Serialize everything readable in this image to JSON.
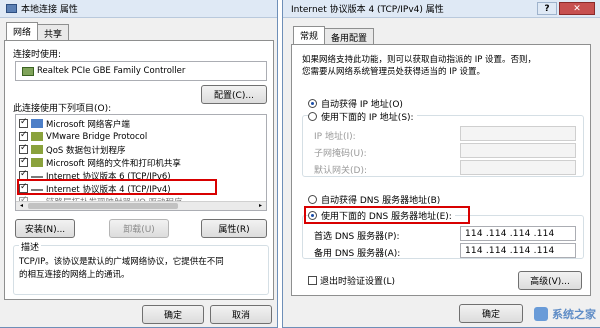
{
  "left_window": {
    "title": "本地连接 属性",
    "tabs": [
      "网络",
      "共享"
    ],
    "connect_using_label": "连接时使用:",
    "adapter": "Realtek PCIe GBE Family Controller",
    "configure_button": "配置(C)...",
    "items_label": "此连接使用下列项目(O):",
    "items": [
      {
        "label": "Microsoft 网络客户端",
        "checked": true
      },
      {
        "label": "VMware Bridge Protocol",
        "checked": true
      },
      {
        "label": "QoS 数据包计划程序",
        "checked": true
      },
      {
        "label": "Microsoft 网络的文件和打印机共享",
        "checked": true
      },
      {
        "label": "Internet 协议版本 6 (TCP/IPv6)",
        "checked": true
      },
      {
        "label": "Internet 协议版本 4 (TCP/IPv4)",
        "checked": true
      },
      {
        "label": "链路层拓扑发现映射器 I/O 驱动程序",
        "checked": true
      }
    ],
    "install_button": "安装(N)...",
    "uninstall_button": "卸载(U)",
    "properties_button": "属性(R)",
    "description_label": "描述",
    "description_text_1": "TCP/IP。该协议是默认的广域网络协议，它提供在不同",
    "description_text_2": "的相互连接的网络上的通讯。",
    "ok_button": "确定",
    "cancel_button": "取消"
  },
  "right_window": {
    "title": "Internet 协议版本 4 (TCP/IPv4) 属性",
    "tabs": [
      "常规",
      "备用配置"
    ],
    "intro_1": "如果网络支持此功能，则可以获取自动指派的 IP 设置。否则，",
    "intro_2": "您需要从网络系统管理员处获得适当的 IP 设置。",
    "auto_ip_label": "自动获得 IP 地址(O)",
    "manual_ip_label": "使用下面的 IP 地址(S):",
    "ip_address_label": "IP 地址(I):",
    "subnet_label": "子网掩码(U):",
    "gateway_label": "默认网关(D):",
    "auto_dns_label": "自动获得 DNS 服务器地址(B)",
    "manual_dns_label": "使用下面的 DNS 服务器地址(E):",
    "preferred_dns_label": "首选 DNS 服务器(P):",
    "preferred_dns_value": "114 .114 .114 .114",
    "alternate_dns_label": "备用 DNS 服务器(A):",
    "alternate_dns_value": "114 .114 .114 .114",
    "validate_label": "退出时验证设置(L)",
    "advanced_button": "高级(V)...",
    "ok_button": "确定",
    "selected_ip_mode": "auto",
    "selected_dns_mode": "manual"
  },
  "watermark": "系统之家",
  "colors": {
    "highlight_border": "#d80000",
    "title_bar": "#dfe9f5",
    "close_button": "#c75050"
  }
}
